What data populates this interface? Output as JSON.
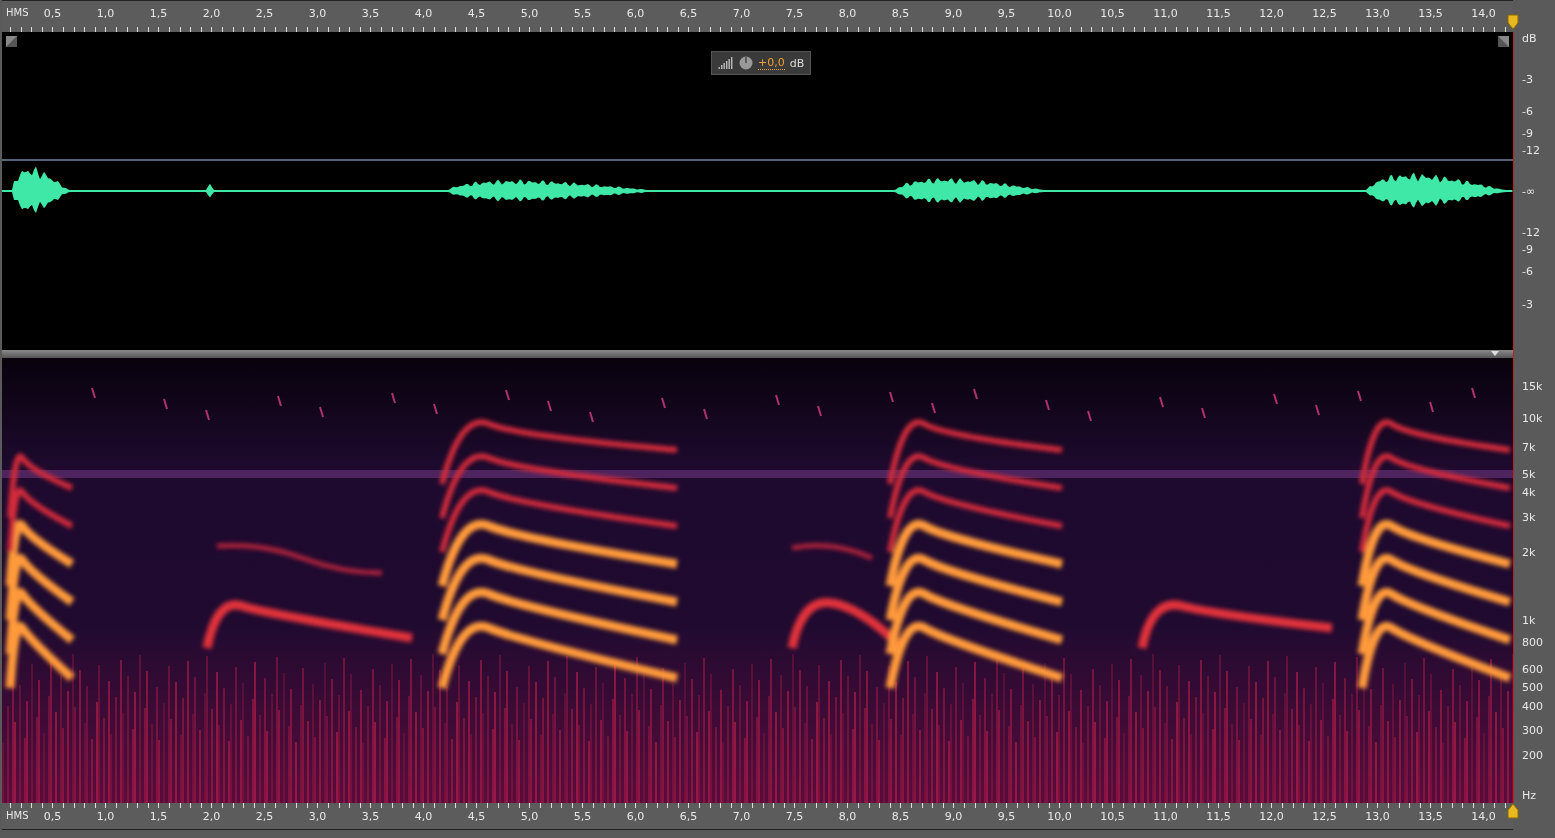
{
  "time_ruler_top": {
    "unit": "HMS",
    "labels": [
      "0,5",
      "1,0",
      "1,5",
      "2,0",
      "2,5",
      "3,0",
      "3,5",
      "4,0",
      "4,5",
      "5,0",
      "5,5",
      "6,0",
      "6,5",
      "7,0",
      "7,5",
      "8,0",
      "8,5",
      "9,0",
      "9,5",
      "10,0",
      "10,5",
      "11,0",
      "11,5",
      "12,0",
      "12,5",
      "13,0",
      "13,5",
      "14,0"
    ]
  },
  "waveform": {
    "gain": {
      "value": "+0,0",
      "unit": "dB"
    },
    "db_scale": [
      "dB",
      "-3",
      "-6",
      "-9",
      "-12",
      "-∞",
      "-12",
      "-9",
      "-6",
      "-3"
    ]
  },
  "spectrogram": {
    "freq_scale": [
      "15k",
      "10k",
      "7k",
      "5k",
      "4k",
      "3k",
      "2k",
      "1k",
      "800",
      "600",
      "500",
      "400",
      "300",
      "200",
      "Hz"
    ]
  },
  "time_ruler_bottom": {
    "unit": "HMS",
    "labels": [
      "0,5",
      "1,0",
      "1,5",
      "2,0",
      "2,5",
      "3,0",
      "3,5",
      "4,0",
      "4,5",
      "5,0",
      "5,5",
      "6,0",
      "6,5",
      "7,0",
      "7,5",
      "8,0",
      "8,5",
      "9,0",
      "9,5",
      "10,0",
      "10,5",
      "11,0",
      "11,5",
      "12,0",
      "12,5",
      "13,0",
      "13,5",
      "14,0"
    ]
  }
}
